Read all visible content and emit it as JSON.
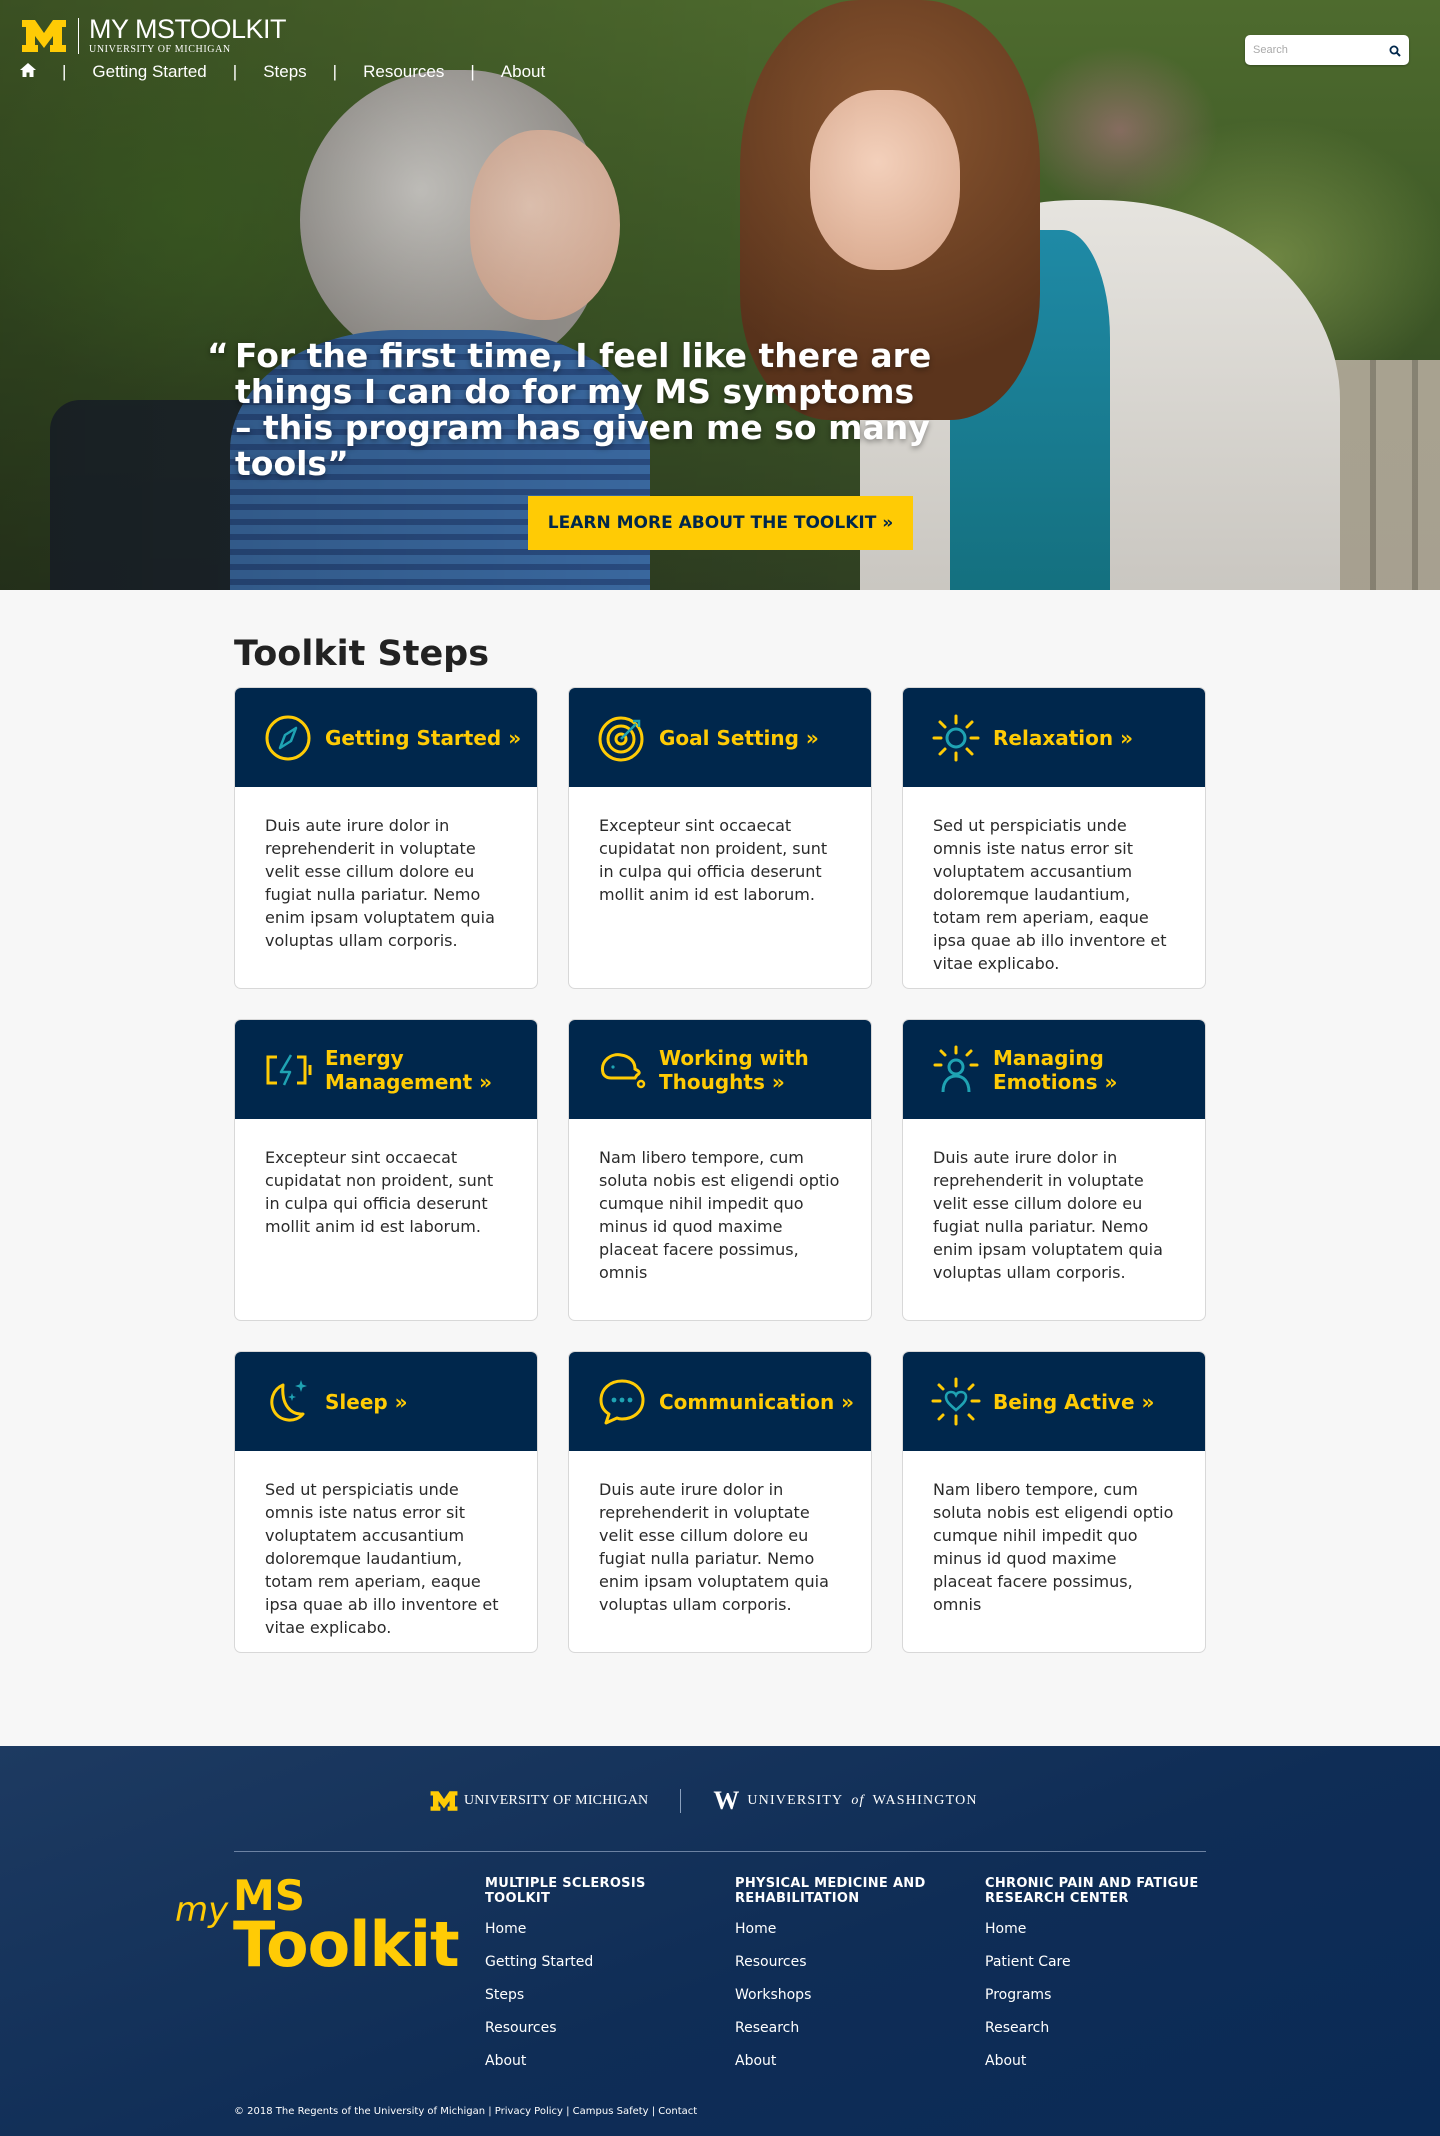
{
  "header": {
    "brand_title": "MY MSTOOLKIT",
    "brand_subtitle": "UNIVERSITY OF MICHIGAN",
    "nav": [
      {
        "label": "Getting Started"
      },
      {
        "label": "Steps"
      },
      {
        "label": "Resources"
      },
      {
        "label": "About"
      }
    ],
    "separator": "|",
    "search_placeholder": "Search"
  },
  "hero": {
    "quote_open": "“",
    "quote_text": "For the first time, I feel like there are things I can do for my MS symptoms – this program has given me so many tools”",
    "cta_label": "LEARN MORE ABOUT THE TOOLKIT »"
  },
  "steps": {
    "title": "Toolkit Steps",
    "cards": [
      {
        "label": "Getting Started »",
        "icon": "compass-icon",
        "text": "Duis aute irure dolor in reprehenderit in voluptate velit esse cillum dolore eu fugiat nulla pariatur. Nemo enim ipsam voluptatem quia voluptas ullam corporis."
      },
      {
        "label": "Goal Setting »",
        "icon": "target-icon",
        "text": "Excepteur sint occaecat cupidatat non proident, sunt in culpa qui officia deserunt mollit anim id est laborum."
      },
      {
        "label": "Relaxation »",
        "icon": "sun-icon",
        "text": "Sed ut perspiciatis unde omnis iste natus error sit voluptatem accusantium doloremque laudantium, totam rem aperiam, eaque ipsa quae ab illo inventore et vitae explicabo."
      },
      {
        "label": "Energy Management »",
        "icon": "battery-bolt-icon",
        "text": "Excepteur sint occaecat cupidatat non proident, sunt in culpa qui officia deserunt mollit anim id est laborum."
      },
      {
        "label": "Working with Thoughts »",
        "icon": "thought-head-icon",
        "text": "Nam libero tempore, cum soluta nobis est eligendi optio cumque nihil impedit quo minus id quod maxime placeat facere possimus, omnis"
      },
      {
        "label": "Managing Emotions »",
        "icon": "person-radiant-icon",
        "text": "Duis aute irure dolor in reprehenderit in voluptate velit esse cillum dolore eu fugiat nulla pariatur. Nemo enim ipsam voluptatem quia voluptas ullam corporis."
      },
      {
        "label": "Sleep »",
        "icon": "moon-stars-icon",
        "text": "Sed ut perspiciatis unde omnis iste natus error sit voluptatem accusantium doloremque laudantium, totam rem aperiam, eaque ipsa quae ab illo inventore et vitae explicabo."
      },
      {
        "label": "Communication »",
        "icon": "speech-bubble-icon",
        "text": "Duis aute irure dolor in reprehenderit in voluptate velit esse cillum dolore eu fugiat nulla pariatur. Nemo enim ipsam voluptatem quia voluptas ullam corporis."
      },
      {
        "label": "Being Active »",
        "icon": "heart-burst-icon",
        "text": "Nam libero tempore, cum soluta nobis est eligendi optio cumque nihil impedit quo minus id quod maxime placeat facere possimus, omnis"
      }
    ]
  },
  "footer": {
    "partner_um": "UNIVERSITY OF MICHIGAN",
    "partner_uw_1": "UNIVERSITY",
    "partner_uw_of": "of",
    "partner_uw_2": "WASHINGTON",
    "logo_my": "my",
    "logo_ms": "MS",
    "logo_toolkit": "Toolkit",
    "columns": [
      {
        "heading": "MULTIPLE SCLEROSIS TOOLKIT",
        "links": [
          "Home",
          "Getting Started",
          "Steps",
          "Resources",
          "About"
        ]
      },
      {
        "heading": "PHYSICAL MEDICINE AND REHABILITATION",
        "links": [
          "Home",
          "Resources",
          "Workshops",
          "Research",
          "About"
        ]
      },
      {
        "heading": "CHRONIC PAIN AND FATIGUE RESEARCH CENTER",
        "links": [
          "Home",
          "Patient Care",
          "Programs",
          "Research",
          "About"
        ]
      }
    ],
    "copyright": "© 2018 The Regents of the University of Michigan  | Privacy Policy | Campus Safety | Contact"
  },
  "colors": {
    "maize": "#ffcb05",
    "navy": "#00274c",
    "teal": "#1fa3b3"
  }
}
